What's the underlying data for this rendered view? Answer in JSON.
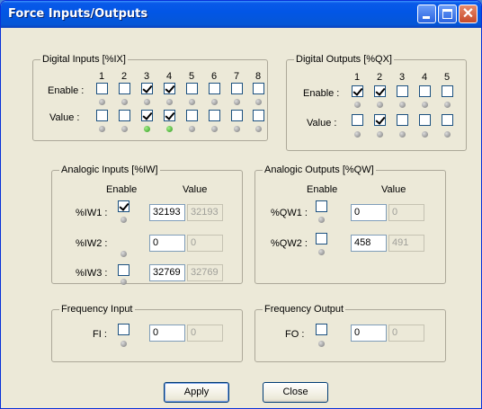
{
  "window": {
    "title": "Force Inputs/Outputs"
  },
  "digital_inputs": {
    "title": "Digital Inputs [%IX]",
    "enable_label": "Enable :",
    "value_label": "Value :",
    "columns": [
      "1",
      "2",
      "3",
      "4",
      "5",
      "6",
      "7",
      "8"
    ],
    "enable": [
      false,
      false,
      true,
      true,
      false,
      false,
      false,
      false
    ],
    "value": [
      false,
      false,
      true,
      true,
      false,
      false,
      false,
      false
    ],
    "led_on": [
      false,
      false,
      true,
      true,
      false,
      false,
      false,
      false
    ]
  },
  "digital_outputs": {
    "title": "Digital Outputs [%QX]",
    "enable_label": "Enable :",
    "value_label": "Value :",
    "columns": [
      "1",
      "2",
      "3",
      "4",
      "5"
    ],
    "enable": [
      true,
      true,
      false,
      false,
      false
    ],
    "value": [
      false,
      true,
      false,
      false,
      false
    ]
  },
  "analogic_inputs": {
    "title": "Analogic Inputs [%IW]",
    "enable_header": "Enable",
    "value_header": "Value",
    "rows": [
      {
        "label": "%IW1 :",
        "enabled": true,
        "value": "32193",
        "actual": "32193"
      },
      {
        "label": "%IW2 :",
        "enabled": null,
        "value": "0",
        "actual": "0"
      },
      {
        "label": "%IW3 :",
        "enabled": false,
        "value": "32769",
        "actual": "32769"
      }
    ]
  },
  "analogic_outputs": {
    "title": "Analogic Outputs [%QW]",
    "enable_header": "Enable",
    "value_header": "Value",
    "rows": [
      {
        "label": "%QW1 :",
        "enabled": false,
        "value": "0",
        "actual": "0"
      },
      {
        "label": "%QW2 :",
        "enabled": false,
        "value": "458",
        "actual": "491"
      }
    ]
  },
  "frequency_input": {
    "title": "Frequency Input",
    "label": "FI :",
    "enabled": false,
    "value": "0",
    "actual": "0"
  },
  "frequency_output": {
    "title": "Frequency Output",
    "label": "FO :",
    "enabled": false,
    "value": "0",
    "actual": "0"
  },
  "buttons": {
    "apply": "Apply",
    "close": "Close"
  }
}
